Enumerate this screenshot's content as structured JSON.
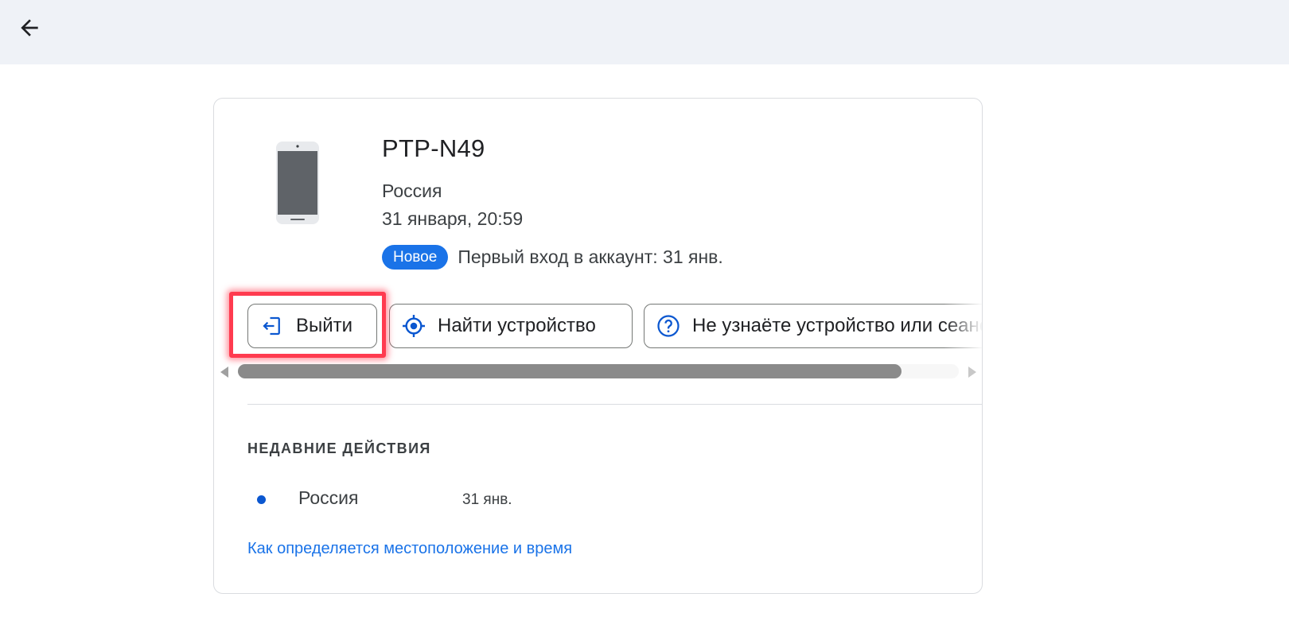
{
  "topbar": {
    "back_icon": "arrow-back-icon"
  },
  "device": {
    "name": "PTP-N49",
    "country": "Россия",
    "time": "31 января, 20:59",
    "image_icon": "smartphone-icon",
    "badge": "Новое",
    "first_login": "Первый вход в аккаунт: 31 янв."
  },
  "actions": {
    "logout_label": "Выйти",
    "logout_icon": "logout-icon",
    "find_label": "Найти устройство",
    "find_icon": "locate-icon",
    "unknown_label": "Не узнаёте устройство или сеанс?",
    "unknown_icon": "help-circle-icon"
  },
  "scrollbar": {
    "thumb_fraction": 0.92
  },
  "recent": {
    "title": "НЕДАВНИЕ ДЕЙСТВИЯ",
    "items": [
      {
        "place": "Россия",
        "date": "31 янв."
      }
    ]
  },
  "help_link": "Как определяется местоположение и время",
  "colors": {
    "accent": "#1a73e8",
    "badge_bg": "#1a73e8",
    "dot": "#0b57d0",
    "highlight": "#ff3b4f",
    "topbar_bg": "#eff2f7"
  }
}
